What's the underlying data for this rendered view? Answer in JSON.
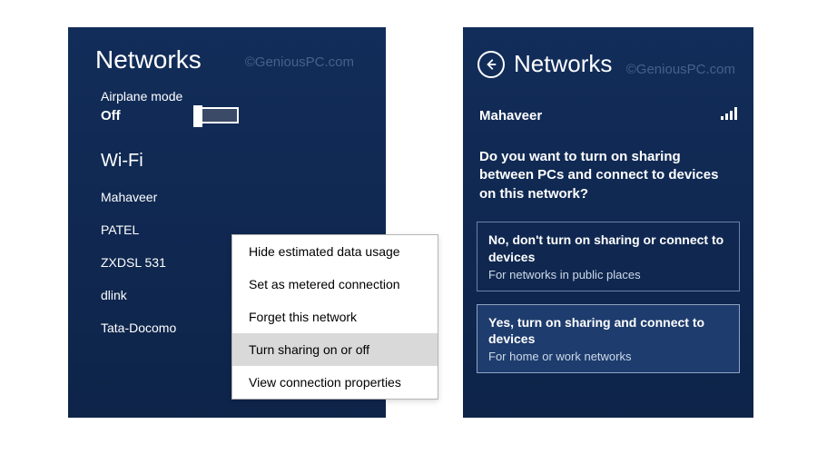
{
  "watermark": "©GeniousPC.com",
  "left": {
    "title": "Networks",
    "airplane_label": "Airplane mode",
    "airplane_status": "Off",
    "wifi_label": "Wi-Fi",
    "items": [
      "Mahaveer",
      "PATEL",
      "ZXDSL 531",
      "dlink",
      "Tata-Docomo"
    ],
    "context_menu": [
      "Hide estimated data usage",
      "Set as metered connection",
      "Forget this network",
      "Turn sharing on or off",
      "View connection properties"
    ]
  },
  "right": {
    "title": "Networks",
    "network_name": "Mahaveer",
    "prompt": "Do you want to turn on sharing between PCs and connect to devices on this network?",
    "option_no_title": "No, don't turn on sharing or connect to devices",
    "option_no_sub": "For networks in public places",
    "option_yes_title": "Yes, turn on sharing and connect to devices",
    "option_yes_sub": "For home or work networks"
  }
}
